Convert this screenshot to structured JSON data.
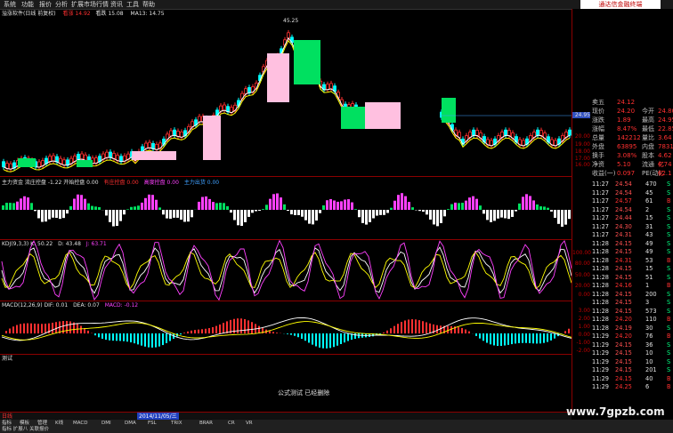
{
  "menu": [
    "系统",
    "功能",
    "报价",
    "分析",
    "扩展市场行情",
    "资讯",
    "工具",
    "帮助"
  ],
  "brand_text": "通达信金融终端",
  "main_panel": {
    "title": "溢涨软件(日线 前复权)",
    "ma_label": "MA13: 14.75",
    "legend_items": [
      {
        "text": "看涨 14.92",
        "color": "#ff3030"
      },
      {
        "text": "看跌 15.08",
        "color": "#e0e0e0"
      }
    ],
    "peak_label": "45.25",
    "price_axis": [
      "20.00",
      "19.00",
      "18.00",
      "17.00",
      "16.00",
      "15.00",
      "14.00"
    ],
    "price_now": "24.95"
  },
  "vol_panel": {
    "title": "主力资金 流庄控盘 -1.22 开始控盘 0.00",
    "items": [
      {
        "text": "有庄控盘 0.00",
        "color": "#ff3030"
      },
      {
        "text": "高度控盘 0.00",
        "color": "#ff40ff"
      },
      {
        "text": "主力出货 0.00",
        "color": "#40a0ff"
      }
    ]
  },
  "kdj_panel": {
    "title": "KDJ(9,3,3) K: 50.22",
    "items": [
      {
        "text": "D: 43.48",
        "color": "#e0e0e0"
      },
      {
        "text": "J: 63.71",
        "color": "#ff40ff"
      }
    ],
    "axis": [
      "100.00",
      "80.00",
      "50.00",
      "20.00",
      "0.00"
    ]
  },
  "macd_panel": {
    "title": "MACD(12,26,9) DIF: 0.01",
    "items": [
      {
        "text": "DEA: 0.07",
        "color": "#e0e0e0"
      },
      {
        "text": "MACD: -0.12",
        "color": "#ff40ff"
      }
    ],
    "axis": [
      "3.00",
      "2.00",
      "1.00",
      "0.00",
      "-1.00",
      "-2.00"
    ]
  },
  "extra_panel": {
    "title": "测试",
    "message": "公式测试 已经删除"
  },
  "quote": [
    {
      "label": "卖五",
      "value": "24.12",
      "vol": ""
    },
    {
      "label": "现价",
      "value": "24.20",
      "vol": "今开",
      "v2": "24.80"
    },
    {
      "label": "涨跌",
      "value": "1.89",
      "vol": "最高",
      "v2": "24.95"
    },
    {
      "label": "涨幅",
      "value": "8.47%",
      "vol": "最低",
      "v2": "22.85"
    },
    {
      "label": "总量",
      "value": "142212",
      "vol": "量比",
      "v2": "3.64"
    },
    {
      "label": "外盘",
      "value": "63895",
      "vol": "内盘",
      "v2": "78317"
    },
    {
      "label": "换手",
      "value": "3.08%",
      "vol": "股本",
      "v2": "4.62亿"
    },
    {
      "label": "净资",
      "value": "5.10",
      "vol": "流通",
      "v2": "4.74亿"
    },
    {
      "label": "收益(一)",
      "value": "0.097",
      "vol": "PE(动)",
      "v2": "62.1"
    }
  ],
  "ticks": [
    {
      "t": "11:27",
      "p": "24.54",
      "v": "470",
      "s": "S"
    },
    {
      "t": "11:27",
      "p": "24.54",
      "v": "45",
      "s": "S"
    },
    {
      "t": "11:27",
      "p": "24.57",
      "v": "61",
      "s": "B"
    },
    {
      "t": "11:27",
      "p": "24.54",
      "v": "2",
      "s": "S"
    },
    {
      "t": "11:27",
      "p": "24.44",
      "v": "15",
      "s": "S"
    },
    {
      "t": "11:27",
      "p": "24.30",
      "v": "31",
      "s": "S"
    },
    {
      "t": "11:27",
      "p": "24.31",
      "v": "43",
      "s": "S"
    },
    {
      "t": "11:28",
      "p": "24.15",
      "v": "49",
      "s": "S"
    },
    {
      "t": "11:28",
      "p": "24.15",
      "v": "49",
      "s": "S"
    },
    {
      "t": "11:28",
      "p": "24.31",
      "v": "53",
      "s": "B"
    },
    {
      "t": "11:28",
      "p": "24.15",
      "v": "15",
      "s": "S"
    },
    {
      "t": "11:28",
      "p": "24.15",
      "v": "51",
      "s": "S"
    },
    {
      "t": "11:28",
      "p": "24.16",
      "v": "1",
      "s": "B"
    },
    {
      "t": "11:28",
      "p": "24.15",
      "v": "200",
      "s": "S"
    },
    {
      "t": "11:28",
      "p": "24.15",
      "v": "3",
      "s": "S"
    },
    {
      "t": "11:28",
      "p": "24.15",
      "v": "573",
      "s": "S"
    },
    {
      "t": "11:28",
      "p": "24.20",
      "v": "110",
      "s": "B"
    },
    {
      "t": "11:28",
      "p": "24.19",
      "v": "30",
      "s": "S"
    },
    {
      "t": "11:29",
      "p": "24.20",
      "v": "76",
      "s": "B"
    },
    {
      "t": "11:29",
      "p": "24.15",
      "v": "36",
      "s": "S"
    },
    {
      "t": "11:29",
      "p": "24.15",
      "v": "10",
      "s": "S"
    },
    {
      "t": "11:29",
      "p": "24.15",
      "v": "10",
      "s": "S"
    },
    {
      "t": "11:29",
      "p": "24.15",
      "v": "201",
      "s": "S"
    },
    {
      "t": "11:29",
      "p": "24.15",
      "v": "40",
      "s": "B"
    },
    {
      "t": "11:29",
      "p": "24.25",
      "v": "6",
      "s": "B"
    }
  ],
  "timebar": {
    "left": "日线",
    "date": "2014/11/05/三"
  },
  "tabs": [
    "指标",
    "模板",
    "管理",
    "K线",
    "MACD",
    "DMI",
    "DMA",
    "FSL",
    "TRIX",
    "BRAR",
    "CR",
    "VR"
  ],
  "status": "指标  扩展八  关联报价",
  "watermark": "www.7gpzb.com",
  "colors": {
    "up": "#ff3030",
    "down": "#00ff80",
    "grid": "#8b0000",
    "bg": "#000000"
  }
}
